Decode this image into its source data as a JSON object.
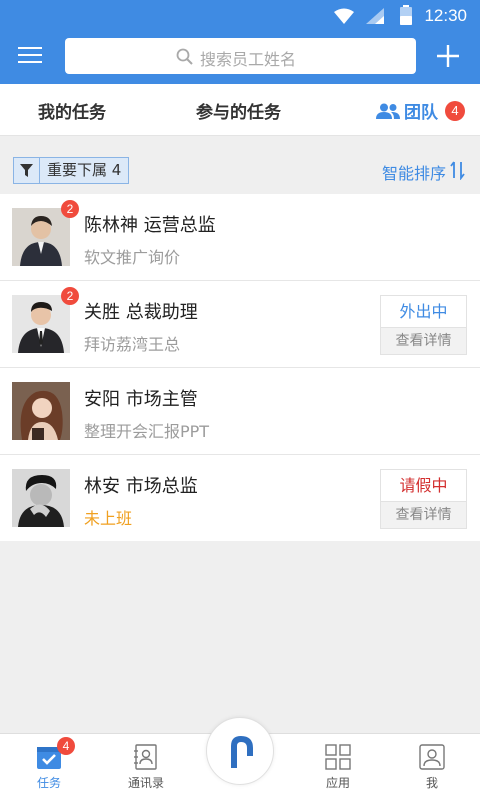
{
  "status": {
    "time": "12:30"
  },
  "search": {
    "placeholder": "搜索员工姓名"
  },
  "tabs": [
    {
      "label": "我的任务"
    },
    {
      "label": "参与的任务"
    },
    {
      "label": "团队",
      "badge": "4"
    }
  ],
  "filter": {
    "label": "重要下属 4"
  },
  "sort": {
    "label": "智能排序"
  },
  "members": [
    {
      "name": "陈林神  运营总监",
      "task": "软文推广询价",
      "badge": "2"
    },
    {
      "name": "关胜  总裁助理",
      "task": "拜访荔湾王总",
      "badge": "2",
      "state": "外出中",
      "detail": "查看详情"
    },
    {
      "name": "安阳  市场主管",
      "task": "整理开会汇报PPT"
    },
    {
      "name": "林安  市场总监",
      "task": "未上班",
      "state": "请假中",
      "detail": "查看详情"
    }
  ],
  "nav": {
    "tasks": "任务",
    "tasks_badge": "4",
    "contacts": "通讯录",
    "apps": "应用",
    "me": "我"
  },
  "colors": {
    "brand": "#3f8be3",
    "badge": "#f04b3d",
    "warn": "#f0a020",
    "leave": "#d32f2f"
  }
}
